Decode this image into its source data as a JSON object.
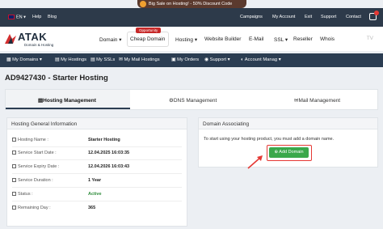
{
  "promo": {
    "text": "Big Sale on Hosting! - 50% Discount Code"
  },
  "topbar": {
    "lang": "EN",
    "lang_caret": "▾",
    "help": "Help",
    "blog": "Blog",
    "campaigns": "Campaigns",
    "my_account": "My Account",
    "exit": "Exit",
    "support": "Support",
    "contact": "Contact"
  },
  "header": {
    "logo_text": "ATAK",
    "logo_sub": "Domain & Hosting",
    "opportunity": "Opportunity",
    "nav": [
      "Domain",
      "Cheap Domain",
      "Hosting",
      "Website Builder",
      "E-Mail",
      "SSL",
      "Reseller",
      "Whois"
    ],
    "tv": "TV"
  },
  "menubar": [
    "My Domains",
    "My Hostings",
    "My SSLs",
    "My Mail Hostings",
    "My Orders",
    "Support",
    "Account Manag"
  ],
  "page_title": "AD9427430 - Starter Hosting",
  "tabs": [
    "Hosting Management",
    "DNS Management",
    "Mail Management"
  ],
  "general": {
    "title": "Hosting General Information",
    "rows": [
      {
        "label": "Hosting Name :",
        "value": "Starter Hosting"
      },
      {
        "label": "Service Start Date :",
        "value": "12.04.2025 16:03:35"
      },
      {
        "label": "Service Expiry Date :",
        "value": "12.04.2026 16:03:43"
      },
      {
        "label": "Service Duration :",
        "value": "1 Year"
      },
      {
        "label": "Status :",
        "value": "Active"
      },
      {
        "label": "Remaining Day :",
        "value": "365"
      }
    ]
  },
  "domain": {
    "title": "Domain Associating",
    "info": "To start using your hosting product, you must add a domain name.",
    "button": "Add Domain"
  },
  "colors": {
    "accent": "#2b3d52",
    "green": "#3aa84b",
    "red": "#e53935"
  }
}
